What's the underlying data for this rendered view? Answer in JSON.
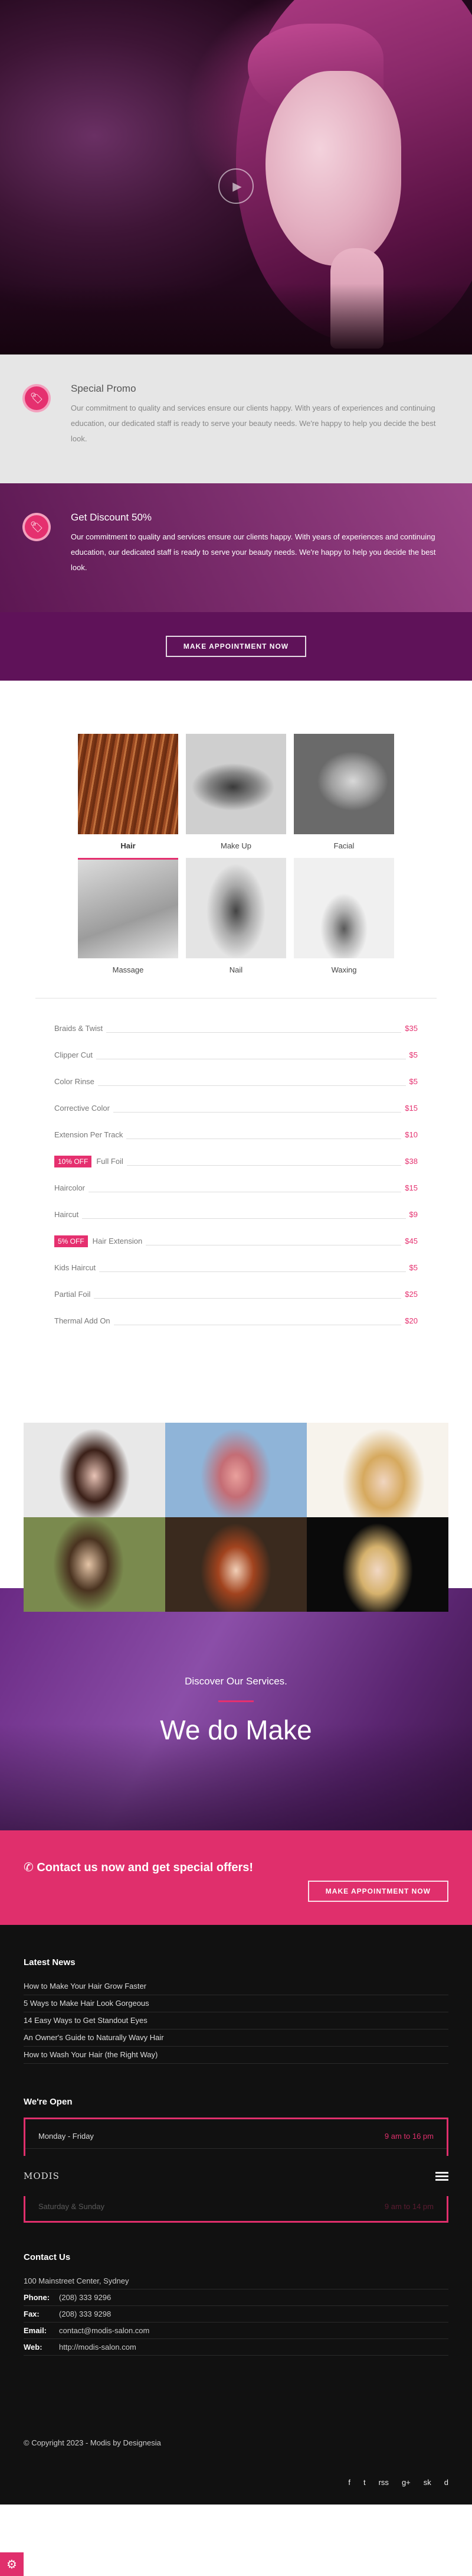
{
  "promo1": {
    "title": "Special Promo",
    "text": "Our commitment to quality and services ensure our clients happy. With years of experiences and continuing education, our dedicated staff is ready to serve your beauty needs. We're happy to help you decide the best look."
  },
  "promo2": {
    "title": "Get Discount 50%",
    "text": "Our commitment to quality and services ensure our clients happy. With years of experiences and continuing education, our dedicated staff is ready to serve your beauty needs. We're happy to help you decide the best look."
  },
  "appointment_label": "MAKE APPOINTMENT NOW",
  "services": [
    "Hair",
    "Make Up",
    "Facial",
    "Massage",
    "Nail",
    "Waxing"
  ],
  "prices": [
    {
      "name": "Braids & Twist",
      "value": "$35"
    },
    {
      "name": "Clipper Cut",
      "value": "$5"
    },
    {
      "name": "Color Rinse",
      "value": "$5"
    },
    {
      "name": "Corrective Color",
      "value": "$15"
    },
    {
      "name": "Extension Per Track",
      "value": "$10"
    },
    {
      "badge": "10% OFF",
      "name": "Full Foil",
      "value": "$38"
    },
    {
      "name": "Haircolor",
      "value": "$15"
    },
    {
      "name": "Haircut",
      "value": "$9"
    },
    {
      "badge": "5% OFF",
      "name": "Hair Extension",
      "value": "$45"
    },
    {
      "name": "Kids Haircut",
      "value": "$5"
    },
    {
      "name": "Partial Foil",
      "value": "$25"
    },
    {
      "name": "Thermal Add On",
      "value": "$20"
    }
  ],
  "discover": {
    "subtitle": "Discover Our Services.",
    "title": "We do Make"
  },
  "cta": {
    "text": "Contact us now and get special offers!",
    "button": "MAKE APPOINTMENT NOW"
  },
  "footer": {
    "news_title": "Latest News",
    "news": [
      "How to Make Your Hair Grow Faster",
      "5 Ways to Make Hair Look Gorgeous",
      "14 Easy Ways to Get Standout Eyes",
      "An Owner's Guide to Naturally Wavy Hair",
      "How to Wash Your Hair (the Right Way)"
    ],
    "hours_title": "We're Open",
    "hours": [
      {
        "day": "Monday - Friday",
        "time": "9 am to 16 pm"
      },
      {
        "day": "Saturday & Sunday",
        "time": "9 am to 14 pm"
      }
    ],
    "logo": "MODIS",
    "contact_title": "Contact Us",
    "address": "100 Mainstreet Center, Sydney",
    "contacts": [
      {
        "label": "Phone:",
        "value": "(208) 333 9296"
      },
      {
        "label": "Fax:",
        "value": "(208) 333 9298"
      },
      {
        "label": "Email:",
        "value": "contact@modis-salon.com"
      },
      {
        "label": "Web:",
        "value": "http://modis-salon.com"
      }
    ],
    "copyright": "© Copyright 2023 - Modis by Designesia",
    "social": [
      "f",
      "t",
      "rss",
      "g+",
      "sk",
      "d"
    ]
  },
  "colors": {
    "accent": "#e5306f",
    "purple": "#5f1259"
  }
}
